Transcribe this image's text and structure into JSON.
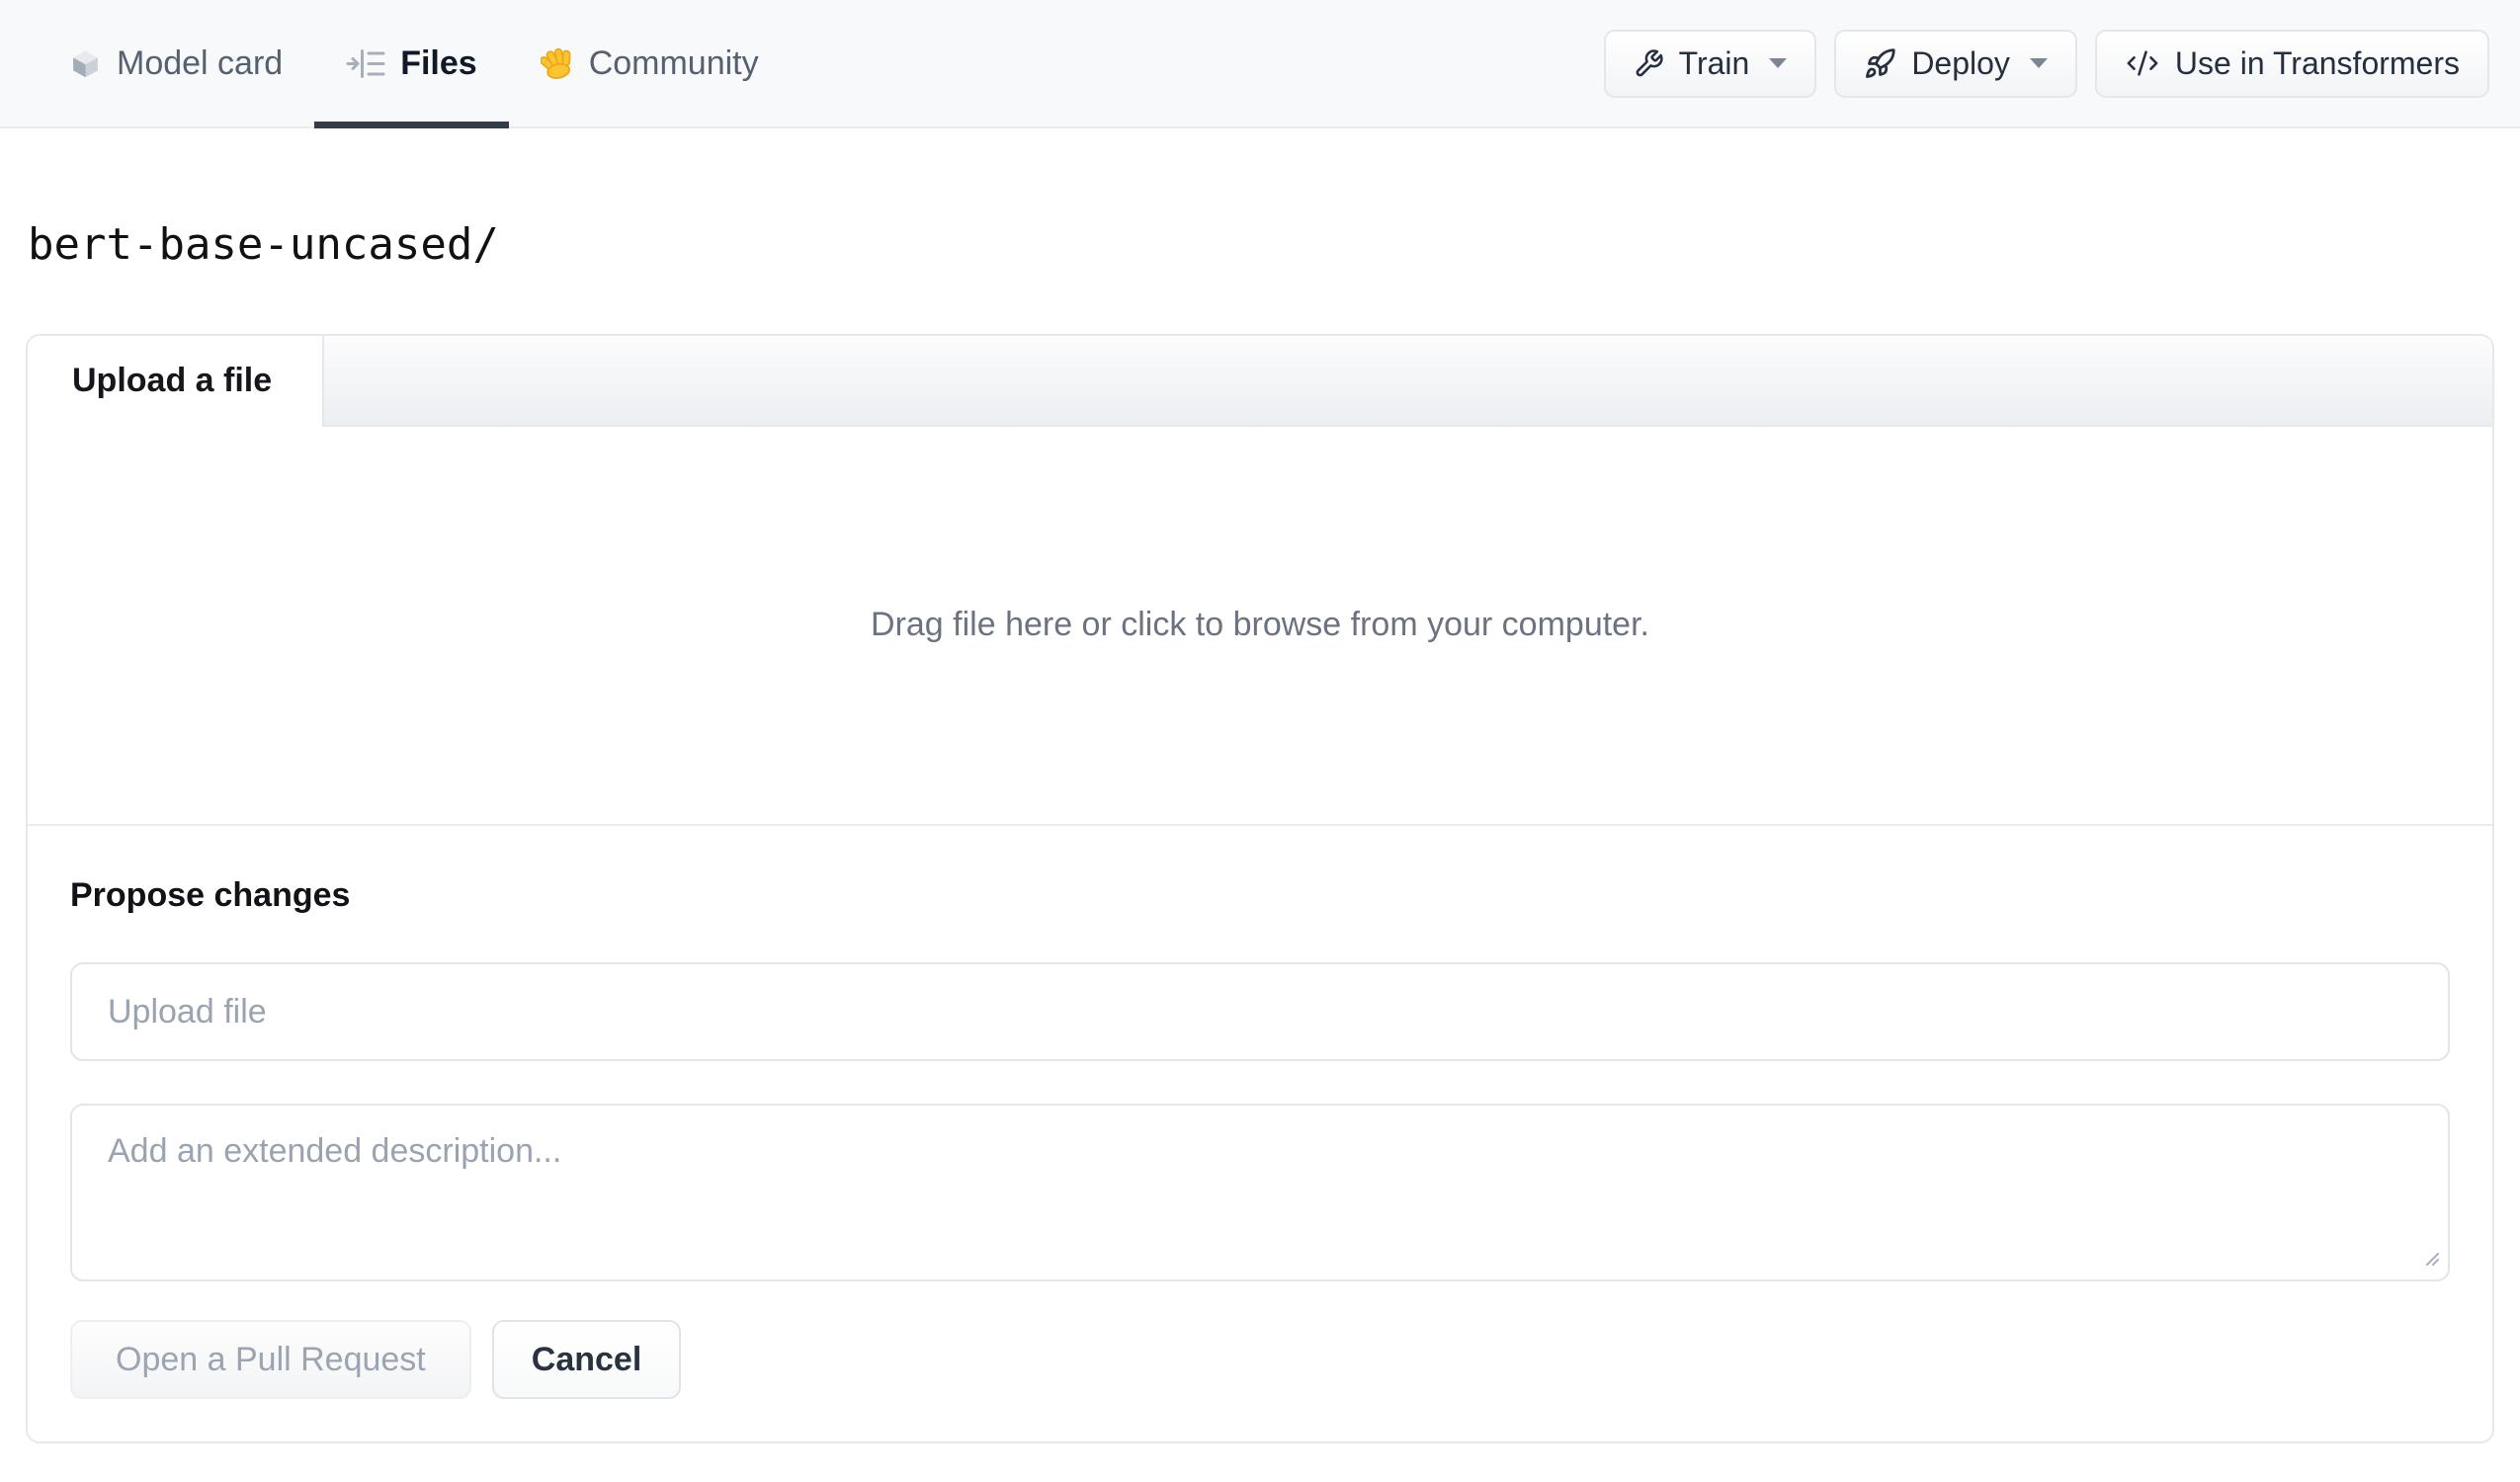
{
  "nav": {
    "items": [
      {
        "label": "Model card",
        "icon": "cube-icon",
        "active": false
      },
      {
        "label": "Files",
        "icon": "files-icon",
        "active": true
      },
      {
        "label": "Community",
        "icon": "wave-icon",
        "active": false
      }
    ],
    "actions": [
      {
        "label": "Train",
        "icon": "wrench-icon",
        "has_caret": true
      },
      {
        "label": "Deploy",
        "icon": "rocket-icon",
        "has_caret": true
      },
      {
        "label": "Use in Transformers",
        "icon": "code-icon",
        "has_caret": false
      }
    ]
  },
  "breadcrumb": {
    "path": "bert-base-uncased/"
  },
  "upload_card": {
    "tab_label": "Upload a file",
    "dropzone_text": "Drag file here or click to browse from your computer.",
    "propose": {
      "heading": "Propose changes",
      "filename_placeholder": "Upload file",
      "description_placeholder": "Add an extended description...",
      "submit_label": "Open a Pull Request",
      "cancel_label": "Cancel"
    }
  },
  "colors": {
    "nav-bg": "#f8f9fb",
    "nav-border": "#e9ebef",
    "active-tab-underline": "#343c4b",
    "nav-label": "#57606f",
    "nav-label-active": "#111827",
    "button-text": "#252f40",
    "button-border": "#e3e6eb",
    "card-border": "#e6e8ec",
    "muted-text": "#6b7280",
    "placeholder": "#9aa3b1",
    "disabled-button-text": "#9ba4b0",
    "heading-text": "#111318"
  }
}
